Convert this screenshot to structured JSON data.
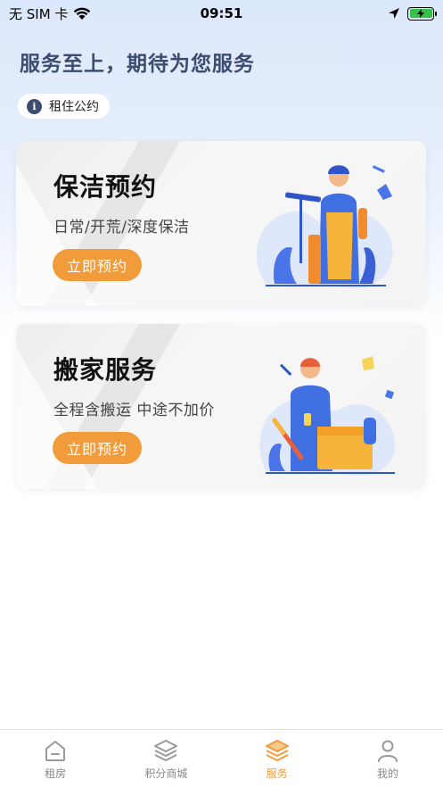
{
  "status_bar": {
    "carrier": "无 SIM 卡",
    "time": "09:51"
  },
  "headline": "服务至上，期待为您服务",
  "rules_pill": {
    "label": "租住公约"
  },
  "cards": [
    {
      "title": "保洁预约",
      "subtitle": "日常/开荒/深度保洁",
      "button": "立即预约"
    },
    {
      "title": "搬家服务",
      "subtitle": "全程含搬运 中途不加价",
      "button": "立即预约"
    }
  ],
  "tabs": [
    {
      "label": "租房",
      "icon": "house-icon",
      "active": false
    },
    {
      "label": "积分商城",
      "icon": "layers-icon",
      "active": false
    },
    {
      "label": "服务",
      "icon": "layers-icon",
      "active": true
    },
    {
      "label": "我的",
      "icon": "person-icon",
      "active": false
    }
  ],
  "colors": {
    "accent": "#f29b3a",
    "headline": "#3d4c6f",
    "battery": "#36c04a"
  }
}
